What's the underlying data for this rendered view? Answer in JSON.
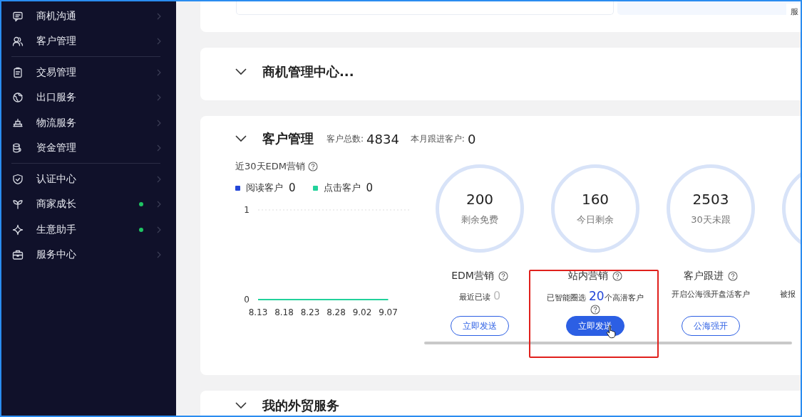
{
  "sidebar": {
    "groups": [
      {
        "items": [
          {
            "label": "商机沟通",
            "kind": "chat",
            "badge": false
          },
          {
            "label": "客户管理",
            "kind": "users",
            "badge": false
          }
        ]
      },
      {
        "items": [
          {
            "label": "交易管理",
            "kind": "clipboard",
            "badge": false
          },
          {
            "label": "出口服务",
            "kind": "globe",
            "badge": false
          },
          {
            "label": "物流服务",
            "kind": "ship",
            "badge": false
          },
          {
            "label": "资金管理",
            "kind": "coins",
            "badge": false
          }
        ]
      },
      {
        "items": [
          {
            "label": "认证中心",
            "kind": "shield",
            "badge": false
          },
          {
            "label": "商家成长",
            "kind": "sprout",
            "badge": true
          },
          {
            "label": "生意助手",
            "kind": "diamond",
            "badge": true
          },
          {
            "label": "服务中心",
            "kind": "briefcase",
            "badge": false
          }
        ]
      }
    ]
  },
  "top_card": {
    "tag": "服"
  },
  "opportunity_card": {
    "title": "商机管理中心..."
  },
  "customer_card": {
    "title": "客户管理",
    "stats": [
      {
        "label": "客户总数:",
        "value": "4834"
      },
      {
        "label": "本月跟进客户:",
        "value": "0"
      }
    ],
    "edm": {
      "title": "近30天EDM营销",
      "legend_counts": [
        "0",
        "0"
      ],
      "chart_data": {
        "type": "line",
        "categories": [
          "8.13",
          "8.18",
          "8.23",
          "8.28",
          "9.02",
          "9.07"
        ],
        "ylim": [
          0,
          1
        ],
        "yticks": [
          0,
          1
        ],
        "series": [
          {
            "name": "阅读客户",
            "color": "#2447d8",
            "values": [
              null,
              null,
              null,
              null,
              null,
              null
            ]
          },
          {
            "name": "点击客户",
            "color": "#22d29b",
            "values": [
              0,
              0,
              0,
              0,
              0,
              0
            ]
          }
        ]
      }
    },
    "columns": [
      {
        "value": "200",
        "label": "剩余免费",
        "title": "EDM营销",
        "desc": "最近已读",
        "count": "0",
        "desc_help": false,
        "button": "立即发送",
        "primary": false,
        "highlighted": false,
        "hovered": false
      },
      {
        "value": "160",
        "label": "今日剩余",
        "title": "站内营销",
        "desc": "已智能圈选 **20**个高潜客户",
        "desc_help": true,
        "button": "立即发送",
        "primary": true,
        "highlighted": true,
        "hovered": true
      },
      {
        "value": "2503",
        "label": "30天未跟",
        "title": "客户跟进",
        "desc": "开启公海强开盘活客户",
        "desc_help": false,
        "button": "公海强开",
        "primary": false,
        "highlighted": false,
        "hovered": false
      },
      {
        "desc": "被报"
      }
    ]
  },
  "trade_card": {
    "title": "我的外贸服务"
  }
}
